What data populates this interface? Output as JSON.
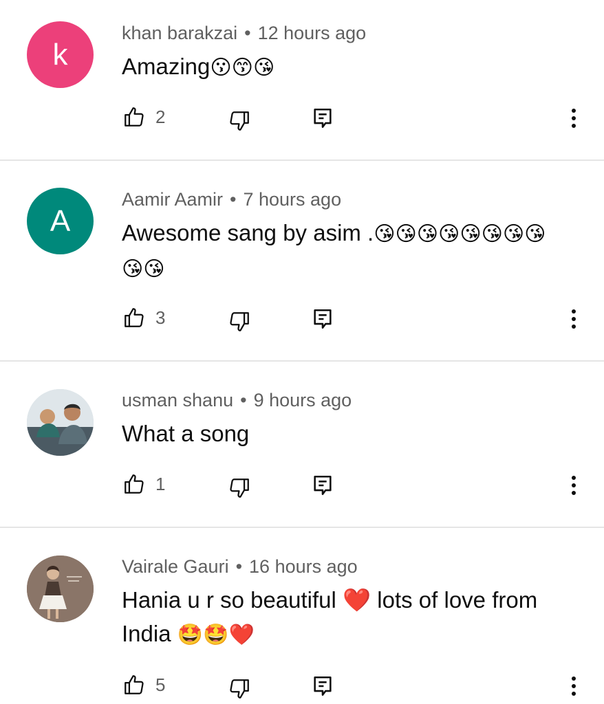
{
  "comments": [
    {
      "author": "khan barakzai",
      "time": "12 hours ago",
      "text": "Amazing",
      "emojis": "😗😙😘",
      "likes": "2",
      "avatar_letter": "k",
      "avatar_color": "#ec407a"
    },
    {
      "author": "Aamir Aamir",
      "time": "7 hours ago",
      "text": "Awesome sang by asim .",
      "emojis": "😘😘😘😘😘😘😘😘😘😘",
      "likes": "3",
      "avatar_letter": "A",
      "avatar_color": "#00897b"
    },
    {
      "author": "usman shanu",
      "time": "9 hours ago",
      "text": "What a song",
      "emojis": "",
      "likes": "1",
      "avatar_letter": "",
      "avatar_color": "#b8c4cc"
    },
    {
      "author": "Vairale Gauri",
      "time": "16 hours ago",
      "text": "Hania u r so beautiful ❤️ lots of love from India ",
      "emojis": "🤩🤩❤️",
      "likes": "5",
      "avatar_letter": "",
      "avatar_color": "#7d6b5f"
    }
  ],
  "separator": "•",
  "icons": {
    "like": "thumb-up-icon",
    "dislike": "thumb-down-icon",
    "reply": "reply-comment-icon",
    "more": "more-vertical-icon"
  }
}
